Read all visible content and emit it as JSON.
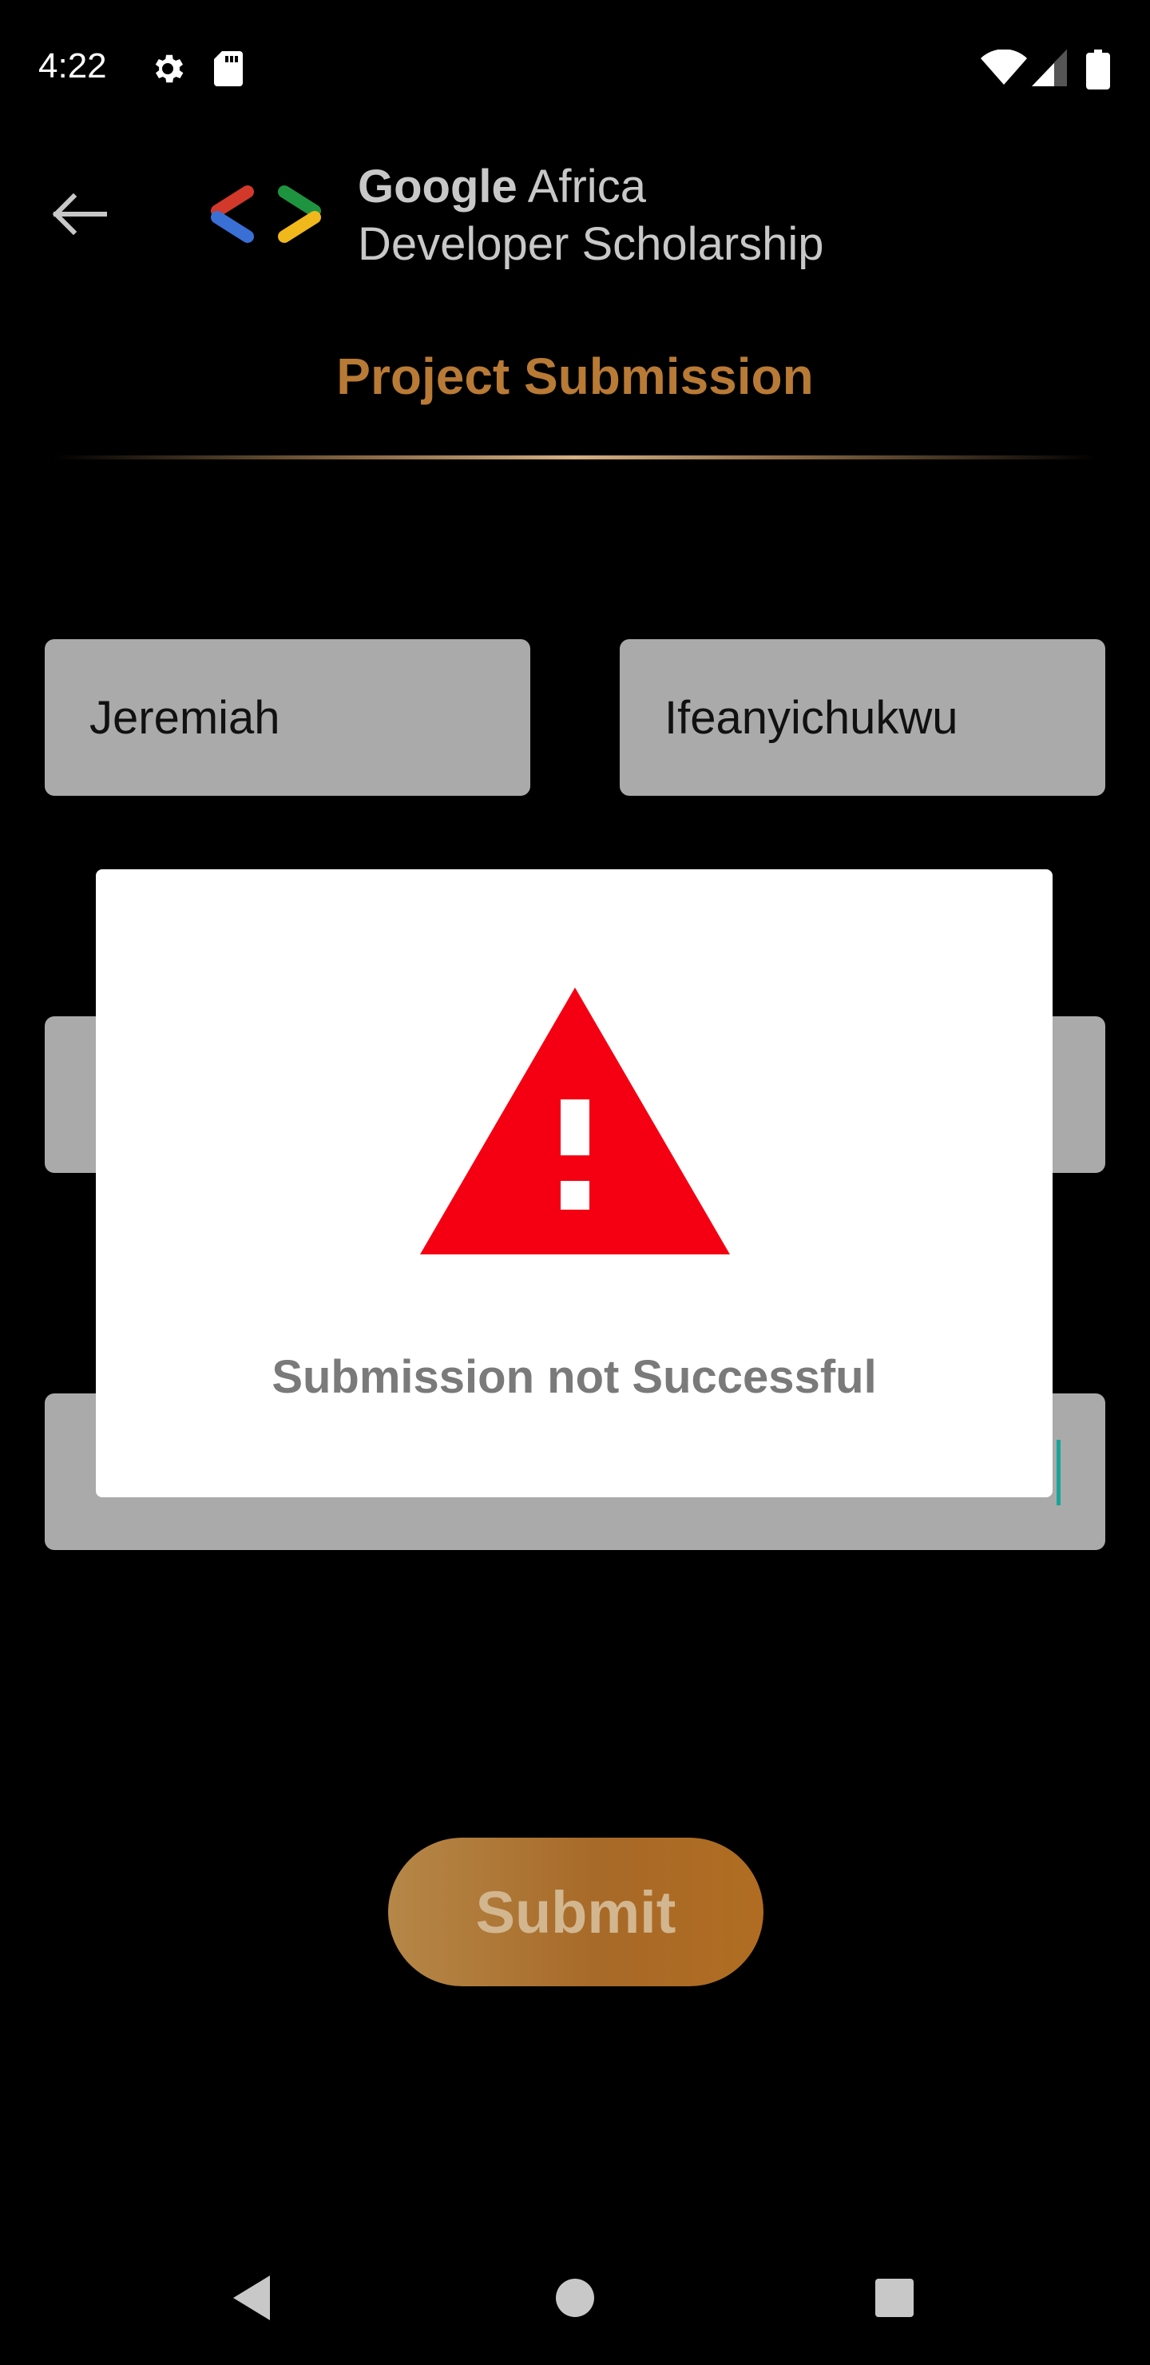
{
  "status_bar": {
    "time": "4:22",
    "icons": [
      "gear-icon",
      "sd-card-icon",
      "wifi-icon",
      "signal-icon",
      "battery-icon"
    ]
  },
  "header": {
    "back_icon": "back-arrow-icon",
    "brand_bold": "Google",
    "brand_rest": " Africa",
    "brand_line2": "Developer Scholarship",
    "title": "Project Submission"
  },
  "form": {
    "first_name": "Jeremiah",
    "last_name": "Ifeanyichukwu",
    "submit_label": "Submit"
  },
  "dialog": {
    "icon": "warning-icon",
    "message": "Submission not Successful"
  },
  "colors": {
    "accent": "#b87a35",
    "warning": "#f40012",
    "field_bg": "#aaaaaa"
  }
}
